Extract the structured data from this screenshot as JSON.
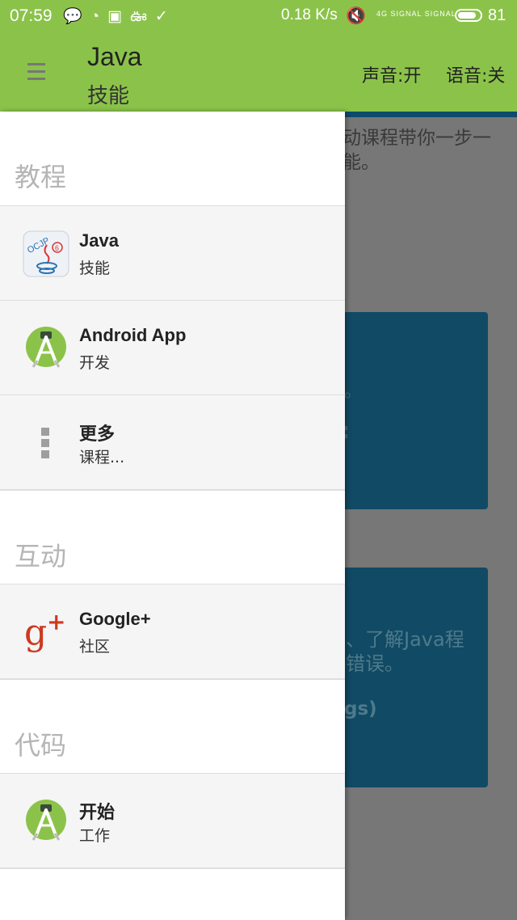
{
  "status_bar": {
    "time": "07:59",
    "net_speed": "0.18 K/s",
    "signal1": "4G SIGNAL",
    "signal2": "SIGNAL",
    "battery": "81"
  },
  "app_bar": {
    "title": "Java",
    "subtitle": "技能",
    "sound": "声音:开",
    "voice": "语音:关"
  },
  "background": {
    "desc_line1": "动课程带你一步一",
    "desc_line2": "能。",
    "card1_text": "。",
    "card2_line1": "、了解Java程",
    "card2_line2": "错误。",
    "card2_bold": "gs)"
  },
  "drawer": {
    "sections": [
      {
        "title": "教程",
        "items": [
          {
            "name": "Java",
            "sub": "技能",
            "icon": "java-ocjp-icon"
          },
          {
            "name": "Android App",
            "sub": "开发",
            "icon": "android-studio-icon"
          },
          {
            "name": "更多",
            "sub": "课程...",
            "icon": "more-vert-icon"
          }
        ]
      },
      {
        "title": "互动",
        "items": [
          {
            "name": "Google+",
            "sub": "社区",
            "icon": "google-plus-icon"
          }
        ]
      },
      {
        "title": "代码",
        "items": [
          {
            "name": "开始",
            "sub": "工作",
            "icon": "android-studio-icon"
          }
        ]
      }
    ]
  },
  "colors": {
    "appbar": "#8bc34a",
    "card": "#114a64",
    "scrim": "#777777"
  }
}
